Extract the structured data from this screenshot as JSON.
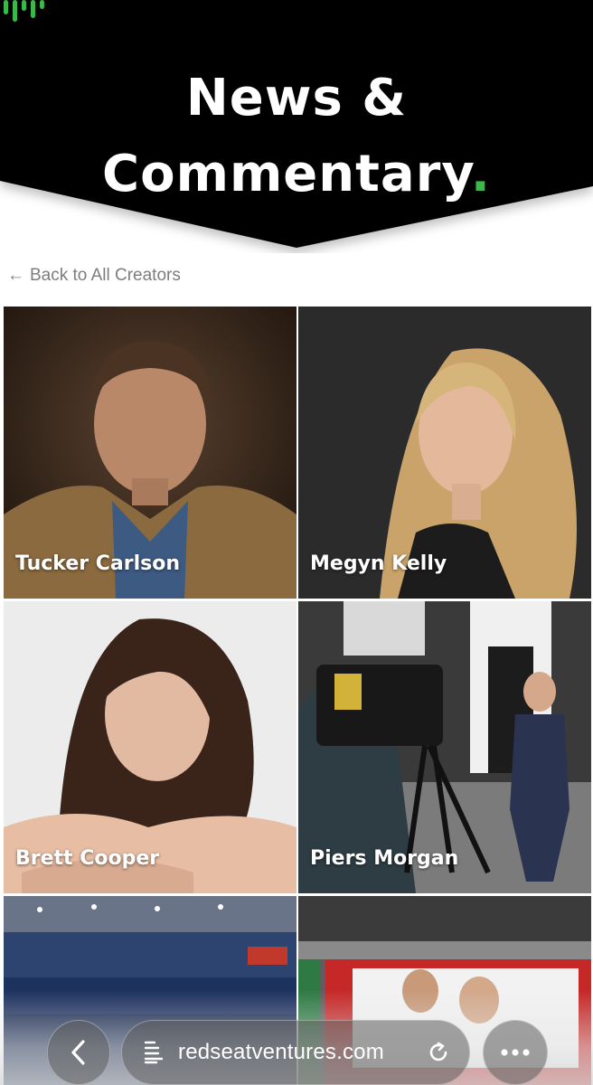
{
  "header": {
    "title_line1": "News &",
    "title_line2": "Commentary",
    "title_dot": ".",
    "accent_color": "#3ab84a",
    "logo_icon": "sound-bars-logo"
  },
  "back_link": {
    "arrow": "←",
    "label": "Back to All Creators"
  },
  "creators": [
    {
      "name": "Tucker Carlson"
    },
    {
      "name": "Megyn Kelly"
    },
    {
      "name": "Brett Cooper"
    },
    {
      "name": "Piers Morgan"
    },
    {
      "name": ""
    },
    {
      "name": ""
    }
  ],
  "browser_bar": {
    "back_icon": "chevron-left-icon",
    "page_icon": "page-lines-icon",
    "url": "redseatventures.com",
    "reload_icon": "reload-icon",
    "more_icon": "more-dots-icon"
  }
}
